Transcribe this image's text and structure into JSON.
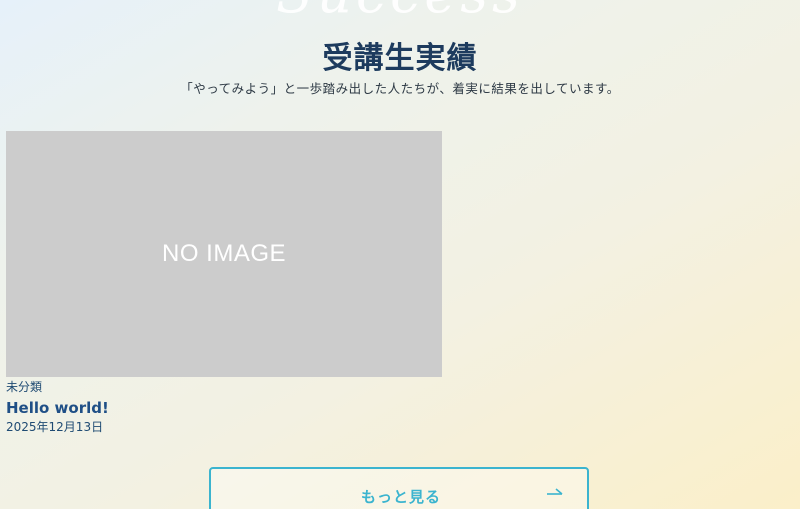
{
  "section": {
    "deco_text": "Success",
    "title": "受講生実績",
    "lead": "「やってみよう」と一歩踏み出した人たちが、着実に結果を出しています。"
  },
  "posts": [
    {
      "thumbnail_text": "NO IMAGE",
      "category": "未分類",
      "title": "Hello world!",
      "date": "2025年12月13日"
    }
  ],
  "more_button": {
    "label": "もっと見る",
    "icon": "arrow-right-icon"
  },
  "colors": {
    "title": "#1d3b5e",
    "accent": "#3bb4cf",
    "placeholder_bg": "#cccccc",
    "link": "#1f4f86"
  }
}
